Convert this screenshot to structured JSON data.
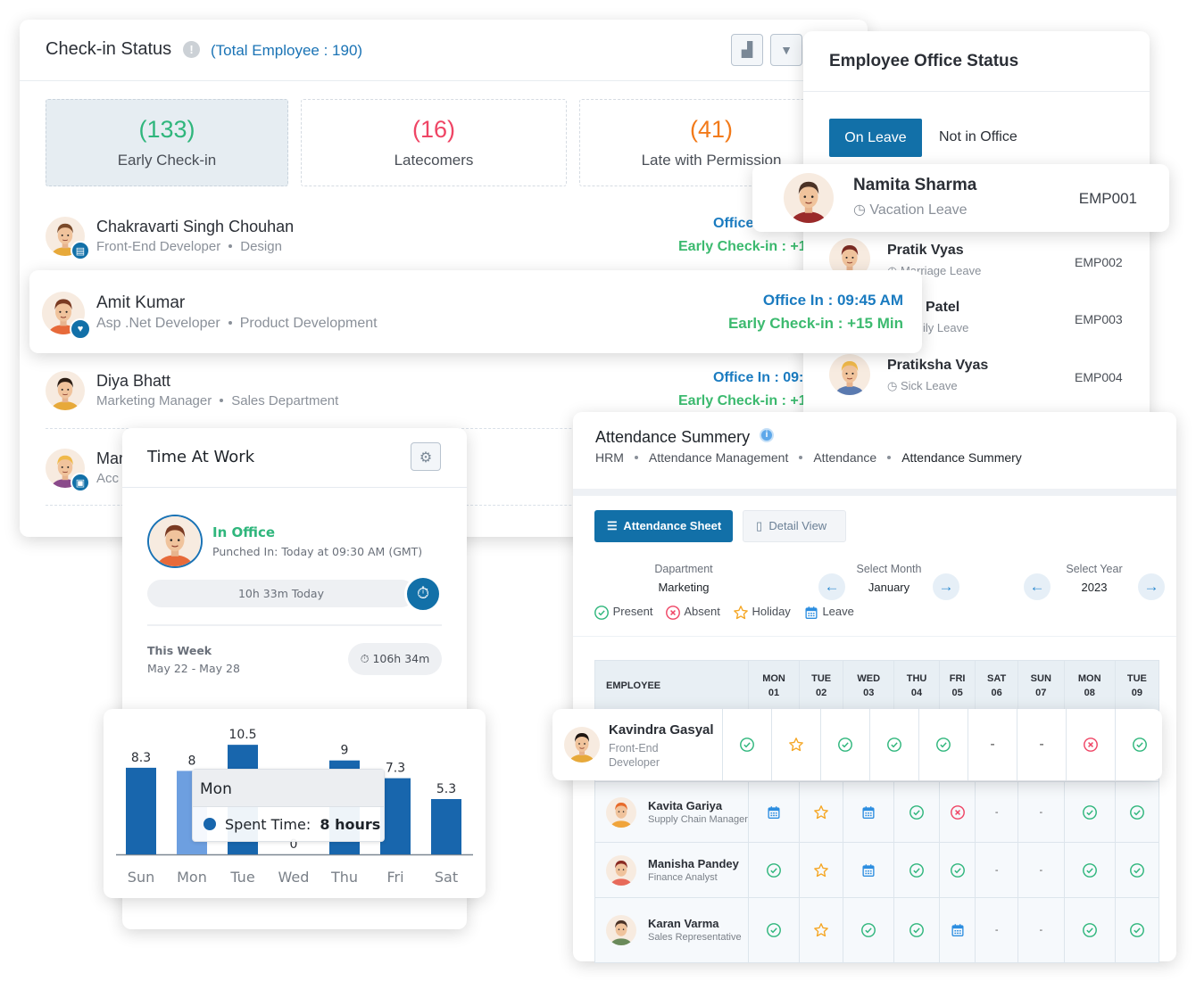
{
  "checkin": {
    "title": "Check-in Status",
    "total": "(Total Employee : 190)",
    "chart_button_icon": "bar-chart-icon",
    "filter_button_icon": "filter-icon",
    "stats": [
      {
        "count": "(133)",
        "label": "Early Check-in",
        "color": "#2fb67c"
      },
      {
        "count": "(16)",
        "label": "Latecomers",
        "color": "#ef4565"
      },
      {
        "count": "(41)",
        "label": "Late with Permission",
        "color": "#f27a1a"
      }
    ],
    "rows": [
      {
        "name": "Chakravarti Singh Chouhan",
        "role": "Front-End Developer",
        "dept": "Design",
        "office_in": "Office",
        "early": "Early Check-in : +1"
      },
      {
        "name": "Amit Kumar",
        "role": "Asp .Net Developer",
        "dept": "Product Development",
        "office_in": "Office In : 09:45 AM",
        "early": "Early Check-in : +15 Min"
      },
      {
        "name": "Diya Bhatt",
        "role": "Marketing Manager",
        "dept": "Sales Department",
        "office_in": "Office In : 09:",
        "early": "Early Check-in : +1"
      },
      {
        "name": "Mar",
        "role": "Acc"
      }
    ]
  },
  "office_status": {
    "title": "Employee Office Status",
    "tabs": [
      "On Leave",
      "Not in Office"
    ],
    "rows": [
      {
        "name": "Namita Sharma",
        "leave": "Vacation Leave",
        "id": "EMP001"
      },
      {
        "name": "Pratik Vyas",
        "leave": "Marriage Leave",
        "id": "EMP002"
      },
      {
        "name": "Patel",
        "leave": "ily Leave",
        "id": "EMP003"
      },
      {
        "name": "Pratiksha Vyas",
        "leave": "Sick Leave",
        "id": "EMP004"
      }
    ]
  },
  "time_at_work": {
    "title": "Time At Work",
    "status": "In Office",
    "punched": "Punched In: Today at 09:30 AM (GMT)",
    "today": "10h 33m Today",
    "week_label": "This Week",
    "week_range": "May 22 - May 28",
    "week_total": "106h 34m",
    "tooltip": {
      "day": "Mon",
      "label": "Spent Time:",
      "value": "8 hours"
    }
  },
  "chart_data": {
    "type": "bar",
    "categories": [
      "Sun",
      "Mon",
      "Tue",
      "Wed",
      "Thu",
      "Fri",
      "Sat"
    ],
    "values": [
      8.3,
      8,
      10.5,
      0,
      9,
      7.3,
      5.3
    ],
    "highlighted": "Mon",
    "colors": {
      "bar": "#1866ad",
      "highlight": "#6d9fe0"
    }
  },
  "attendance": {
    "title": "Attendance Summery",
    "breadcrumb": [
      "HRM",
      "Attendance Management",
      "Attendance",
      "Attendance Summery"
    ],
    "buttons": {
      "sheet": "Attendance Sheet",
      "detail": "Detail View"
    },
    "filters": {
      "department": {
        "label": "Dapartment",
        "value": "Marketing"
      },
      "month": {
        "label": "Select Month",
        "value": "January"
      },
      "year": {
        "label": "Select Year",
        "value": "2023"
      }
    },
    "legend": {
      "P": "Present",
      "A": "Absent",
      "H": "Holiday",
      "L": "Leave"
    },
    "header": {
      "employee": "EMPLOYEE",
      "days": [
        [
          "MON",
          "01"
        ],
        [
          "TUE",
          "02"
        ],
        [
          "WED",
          "03"
        ],
        [
          "THU",
          "04"
        ],
        [
          "FRI",
          "05"
        ],
        [
          "SAT",
          "06"
        ],
        [
          "SUN",
          "07"
        ],
        [
          "MON",
          "08"
        ],
        [
          "TUE",
          "09"
        ]
      ]
    },
    "rows": [
      {
        "name": "Kavindra Gasyal",
        "role": "Front-End Developer",
        "status": [
          "P",
          "H",
          "P",
          "P",
          "P",
          "-",
          "-",
          "A",
          "P"
        ]
      },
      {
        "name": "Kavita Gariya",
        "role": "Supply Chain Manager",
        "status": [
          "L",
          "H",
          "L",
          "P",
          "A",
          "-",
          "-",
          "P",
          "P"
        ]
      },
      {
        "name": "Manisha Pandey",
        "role": "Finance Analyst",
        "status": [
          "P",
          "H",
          "L",
          "P",
          "P",
          "-",
          "-",
          "P",
          "P"
        ]
      },
      {
        "name": "Karan Varma",
        "role": "Sales Representative",
        "status": [
          "P",
          "H",
          "P",
          "P",
          "L",
          "-",
          "-",
          "P",
          "P"
        ]
      }
    ],
    "colors": {
      "P": "#2fb67c",
      "A": "#ef4565",
      "H": "#f5a623",
      "L": "#2d8ee0"
    }
  }
}
